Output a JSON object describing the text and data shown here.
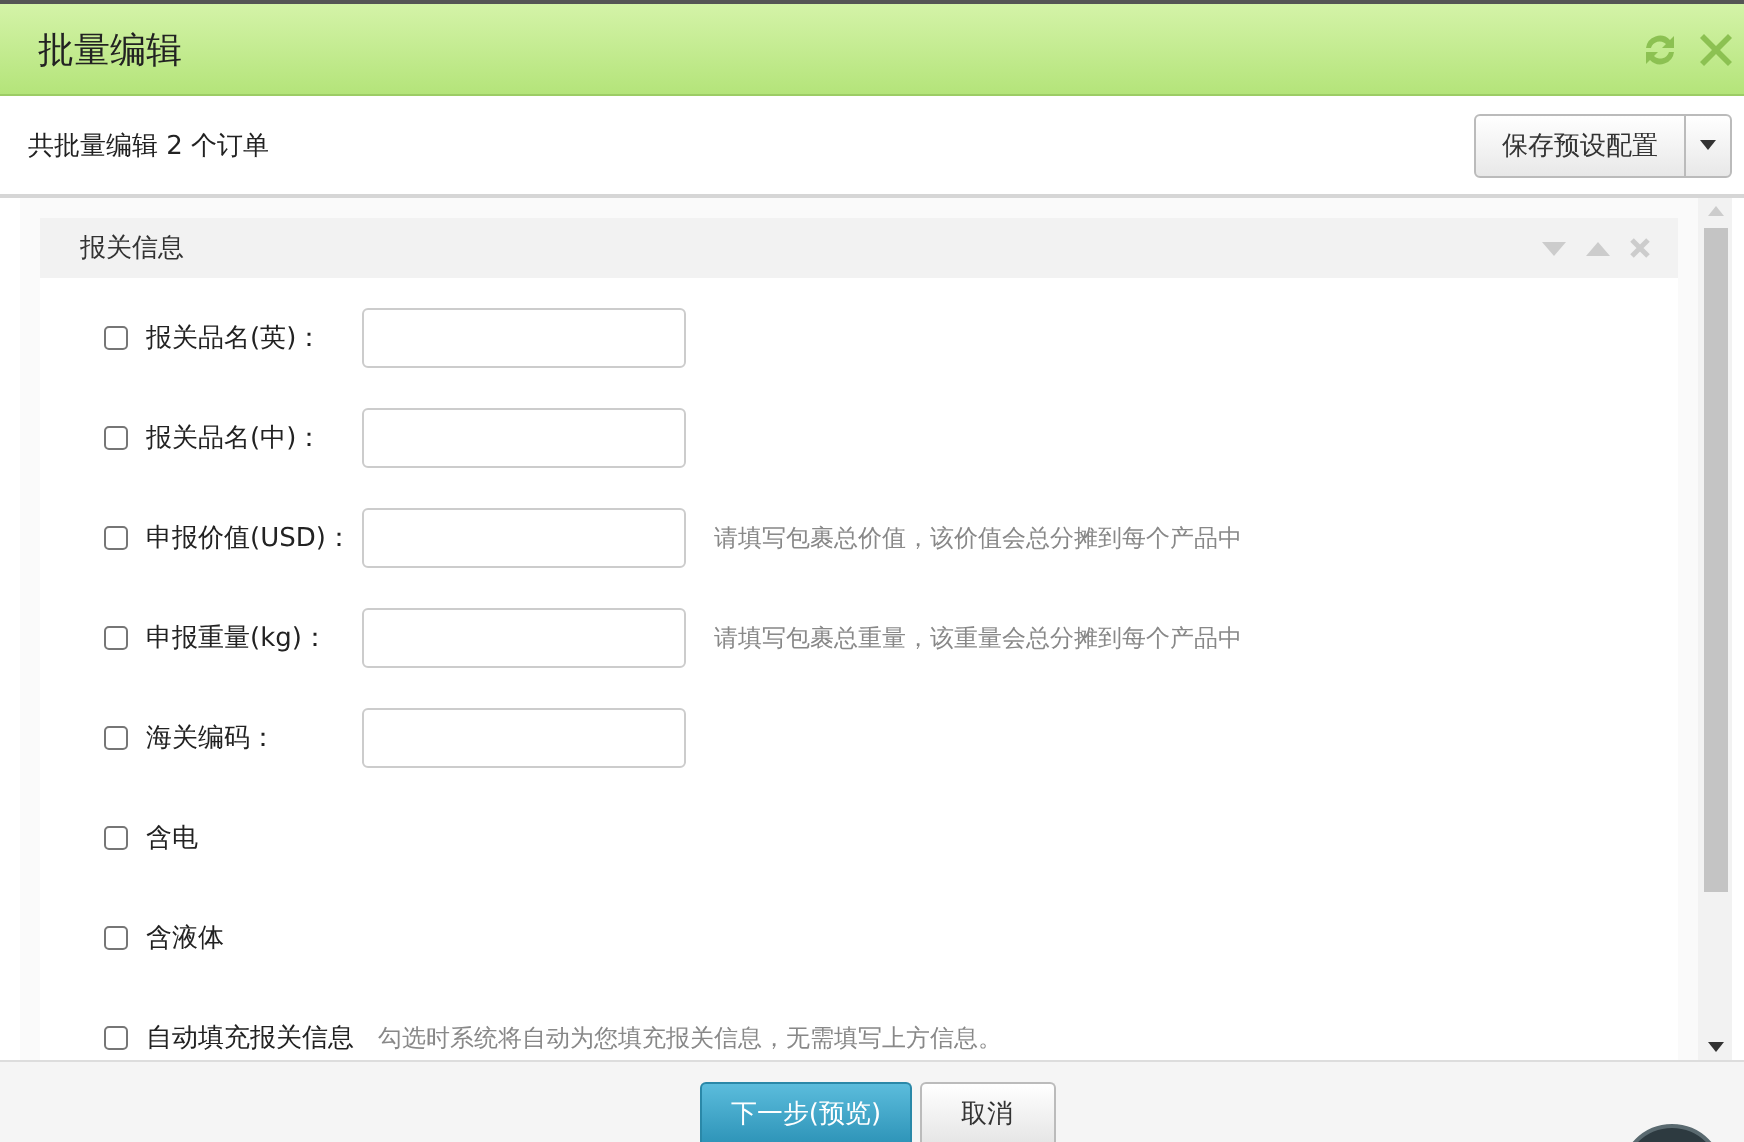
{
  "window": {
    "title": "批量编辑"
  },
  "summary": "共批量编辑 2 个订单",
  "save_preset_button": "保存预设配置",
  "section": {
    "title": "报关信息",
    "fields": [
      {
        "kind": "input",
        "label": "报关品名(英)：",
        "checked": false
      },
      {
        "kind": "input",
        "label": "报关品名(中)：",
        "checked": false
      },
      {
        "kind": "input",
        "label": "申报价值(USD)：",
        "checked": false,
        "hint": "请填写包裹总价值，该价值会总分摊到每个产品中"
      },
      {
        "kind": "input",
        "label": "申报重量(kg)：",
        "checked": false,
        "hint": "请填写包裹总重量，该重量会总分摊到每个产品中"
      },
      {
        "kind": "input",
        "label": "海关编码：",
        "checked": false
      },
      {
        "kind": "check",
        "label": "含电",
        "checked": false
      },
      {
        "kind": "check",
        "label": "含液体",
        "checked": false
      },
      {
        "kind": "check",
        "label": "自动填充报关信息",
        "checked": false,
        "hint": "勾选时系统将自动为您填充报关信息，无需填写上方信息。"
      }
    ]
  },
  "buttons": [
    {
      "label": "下一步(预览)",
      "kind": "primary"
    },
    {
      "label": "取消",
      "kind": "default"
    }
  ]
}
